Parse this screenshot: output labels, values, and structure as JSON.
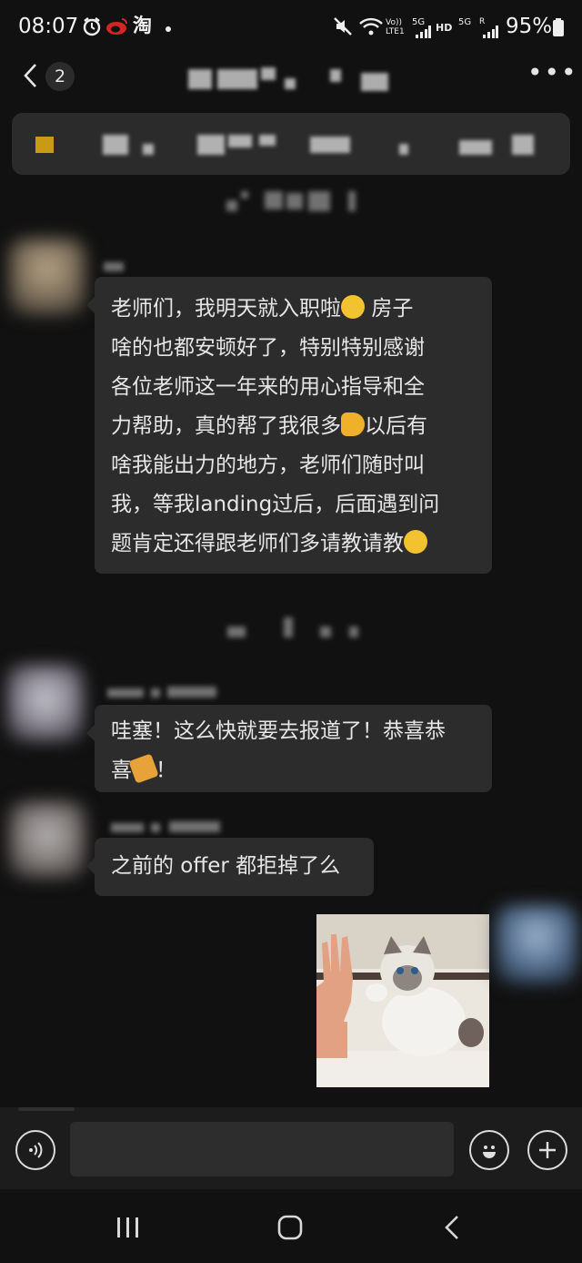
{
  "status_bar": {
    "time": "08:07",
    "battery": "95%",
    "icons": [
      "alarm-icon",
      "weibo-icon",
      "taobao-icon",
      "mute-icon",
      "wifi-icon",
      "signal-icon",
      "battery-icon"
    ],
    "taobao_char": "淘",
    "volte_label": "Vo)) LTE1",
    "net_label_1": "5G",
    "hd_label": "HD",
    "net_label_2": "5G"
  },
  "header": {
    "unread_count": "2"
  },
  "messages": [
    {
      "lines": [
        "老师们，我明天就入职啦",
        "啥的也都安顿好了，特别特别感谢",
        "各位老师这一年来的用心指导和全",
        "力帮助，真的帮了我很多",
        "啥我能出力的地方，老师们随时叫",
        "我，等我landing过后，后面遇到问",
        "题肯定还得跟老师们多请教请教"
      ],
      "line1_tail": "房子",
      "line4_tail": "以后有"
    },
    {
      "lines": [
        "哇塞！这么快就要去报道了！恭喜恭",
        "喜",
        "！"
      ]
    },
    {
      "text": "之前的 offer 都拒掉了么"
    }
  ],
  "colors": {
    "background": "#111111",
    "bubble": "#2c2c2c",
    "pinned_bar": "#2b2b2b",
    "pin_marker": "#c99a14"
  }
}
